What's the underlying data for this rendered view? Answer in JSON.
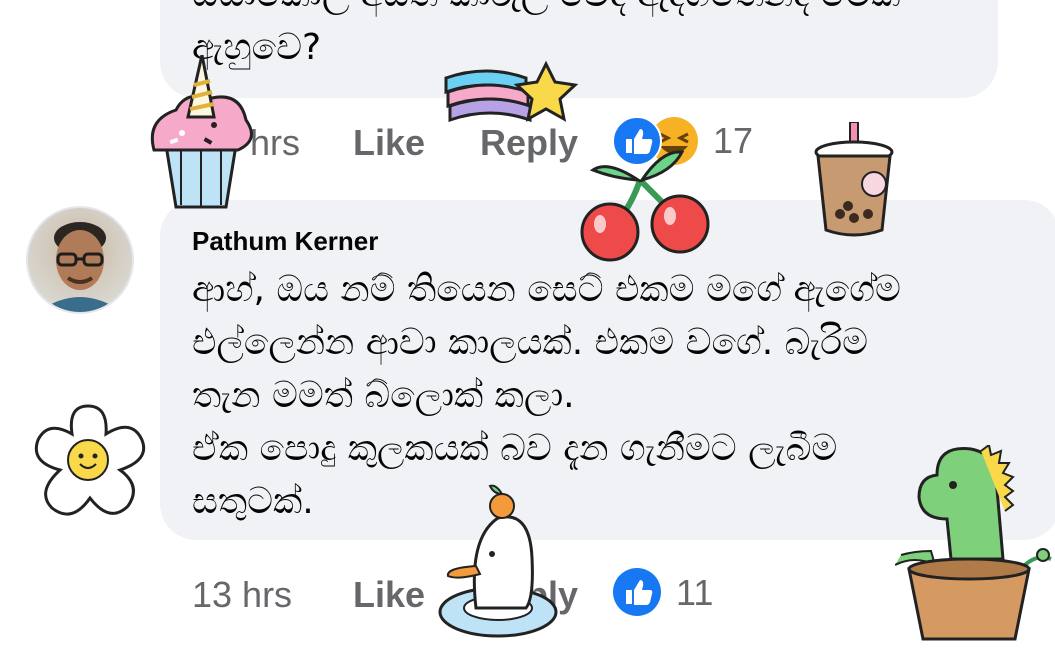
{
  "comments": [
    {
      "text": "ඔයාකොල් අයත් කාරුලි වෙද ඇදගතෙනද මෙක\nඇහුවෙ?",
      "time": "hrs",
      "like_label": "Like",
      "reply_label": "Reply",
      "reaction_count": "17",
      "reactions": [
        "like-icon",
        "haha-icon"
      ]
    },
    {
      "author": "Pathum Kerner",
      "text": "ආහ්, ඔය නම් තියෙන සෙට් එකම මගේ ඇගේම\nඑල්ලෙන්න ආවා කාලයක්. එකම වගේ. බැරිම\nතැන මමත් බ්ලොක් කලා.\nඒක පොදු කුලකයක් බව දැන ගැනීමට ලැබීම\nසතුටක්.",
      "time": "13 hrs",
      "like_label": "Like",
      "reply_label": "Reply",
      "reaction_count": "11",
      "reactions": [
        "like-icon"
      ]
    }
  ],
  "colors": {
    "bubble": "#f0f2f5",
    "meta_text": "#65676b",
    "like_blue": "#1877f2",
    "haha_yellow": "#f7b125"
  },
  "stickers": [
    "cupcake-sticker",
    "rainbow-star-sticker",
    "cherry-sticker",
    "bubble-tea-sticker",
    "flower-sticker",
    "duck-sticker",
    "dinosaur-sticker"
  ]
}
